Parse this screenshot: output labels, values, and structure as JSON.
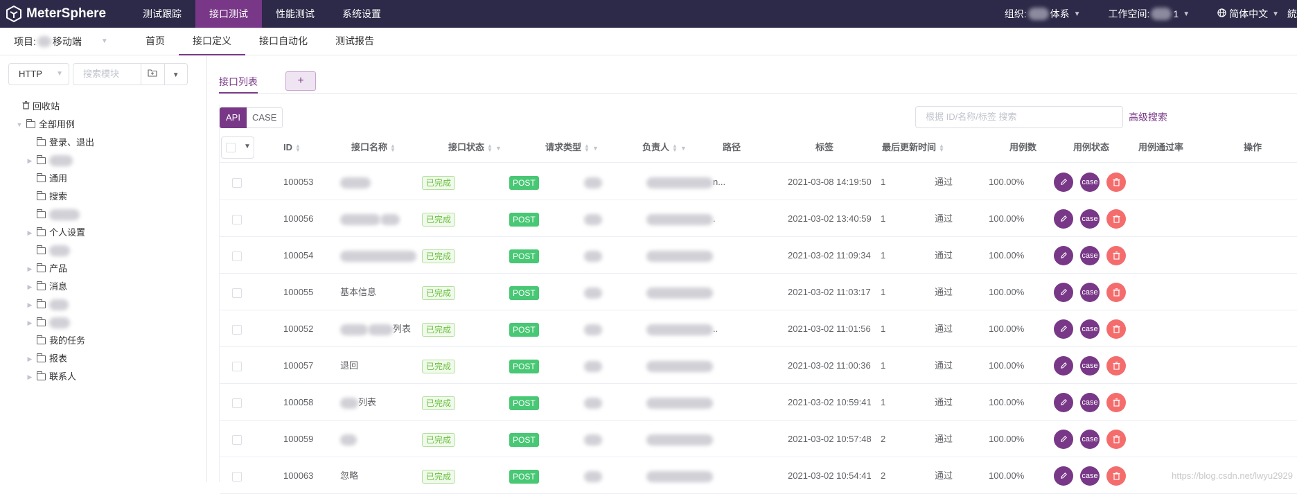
{
  "app": {
    "name": "MeterSphere"
  },
  "topnav": {
    "items": [
      "测试跟踪",
      "接口测试",
      "性能测试",
      "系统设置"
    ],
    "active_index": 1
  },
  "topright": {
    "org_label": "组织:",
    "org_value": "体系",
    "workspace_label": "工作空间:",
    "language": "简体中文"
  },
  "subbar": {
    "project_label": "项目:",
    "project_value": "移动端",
    "items": [
      "首页",
      "接口定义",
      "接口自动化",
      "测试报告"
    ],
    "active_index": 1
  },
  "left": {
    "protocol": "HTTP",
    "search_placeholder": "搜索模块",
    "tree": [
      {
        "label": "回收站",
        "level": 1,
        "type": "trash"
      },
      {
        "label": "全部用例",
        "level": 1,
        "type": "folder",
        "expanded": true
      },
      {
        "label": "登录、退出",
        "level": 2,
        "type": "folder"
      },
      {
        "label": "",
        "level": 2,
        "type": "folder",
        "collapsed": true,
        "blur": 34
      },
      {
        "label": "通用",
        "level": 2,
        "type": "folder"
      },
      {
        "label": "搜索",
        "level": 2,
        "type": "folder"
      },
      {
        "label": "",
        "level": 2,
        "type": "folder",
        "blur": 44
      },
      {
        "label": "个人设置",
        "level": 2,
        "type": "folder",
        "collapsed": true
      },
      {
        "label": "",
        "level": 2,
        "type": "folder",
        "blur": 30
      },
      {
        "label": "产品",
        "level": 2,
        "type": "folder",
        "collapsed": true
      },
      {
        "label": "消息",
        "level": 2,
        "type": "folder",
        "collapsed": true
      },
      {
        "label": "",
        "level": 2,
        "type": "folder",
        "collapsed": true,
        "blur": 28
      },
      {
        "label": "",
        "level": 2,
        "type": "folder",
        "collapsed": true,
        "blur": 30
      },
      {
        "label": "我的任务",
        "level": 2,
        "type": "folder"
      },
      {
        "label": "报表",
        "level": 2,
        "type": "folder",
        "collapsed": true
      },
      {
        "label": "联系人",
        "level": 2,
        "type": "folder",
        "collapsed": true
      }
    ]
  },
  "main": {
    "tab_label": "接口列表",
    "add_tab": "+",
    "mode_api": "API",
    "mode_case": "CASE",
    "search_placeholder": "根据 ID/名称/标签 搜索",
    "advanced_search": "高级搜索",
    "columns": {
      "id": "ID",
      "name": "接口名称",
      "status": "接口状态",
      "method": "请求类型",
      "owner": "负责人",
      "path": "路径",
      "tags": "标签",
      "updated": "最后更新时间",
      "case_count": "用例数",
      "case_status": "用例状态",
      "pass_rate": "用例通过率",
      "ops": "操作"
    },
    "rows": [
      {
        "id": "100053",
        "name": "",
        "name_suffix": "",
        "status": "已完成",
        "method": "POST",
        "path_suffix": "n...",
        "updated": "2021-03-08 14:19:50",
        "case_count": "1",
        "case_status": "通过",
        "pass_rate": "100.00%"
      },
      {
        "id": "100056",
        "name": "",
        "name_suffix": "",
        "status": "已完成",
        "method": "POST",
        "path_suffix": ".",
        "updated": "2021-03-02 13:40:59",
        "case_count": "1",
        "case_status": "通过",
        "pass_rate": "100.00%"
      },
      {
        "id": "100054",
        "name": "",
        "name_suffix": "",
        "status": "已完成",
        "method": "POST",
        "path_suffix": "",
        "updated": "2021-03-02 11:09:34",
        "case_count": "1",
        "case_status": "通过",
        "pass_rate": "100.00%"
      },
      {
        "id": "100055",
        "name": "基本信息",
        "name_suffix": "",
        "status": "已完成",
        "method": "POST",
        "path_suffix": "",
        "updated": "2021-03-02 11:03:17",
        "case_count": "1",
        "case_status": "通过",
        "pass_rate": "100.00%"
      },
      {
        "id": "100052",
        "name": "",
        "name_suffix": "列表",
        "status": "已完成",
        "method": "POST",
        "path_suffix": "..",
        "updated": "2021-03-02 11:01:56",
        "case_count": "1",
        "case_status": "通过",
        "pass_rate": "100.00%"
      },
      {
        "id": "100057",
        "name": "退回",
        "name_suffix": "",
        "status": "已完成",
        "method": "POST",
        "path_suffix": "",
        "updated": "2021-03-02 11:00:36",
        "case_count": "1",
        "case_status": "通过",
        "pass_rate": "100.00%"
      },
      {
        "id": "100058",
        "name": "",
        "name_suffix": "列表",
        "status": "已完成",
        "method": "POST",
        "path_suffix": "",
        "updated": "2021-03-02 10:59:41",
        "case_count": "1",
        "case_status": "通过",
        "pass_rate": "100.00%"
      },
      {
        "id": "100059",
        "name": "",
        "name_suffix": "",
        "status": "已完成",
        "method": "POST",
        "path_suffix": "",
        "updated": "2021-03-02 10:57:48",
        "case_count": "2",
        "case_status": "通过",
        "pass_rate": "100.00%"
      },
      {
        "id": "100063",
        "name": "忽略",
        "name_suffix": "",
        "status": "已完成",
        "method": "POST",
        "path_suffix": "",
        "updated": "2021-03-02 10:54:41",
        "case_count": "2",
        "case_status": "通过",
        "pass_rate": "100.00%"
      }
    ],
    "op_case_label": "case"
  },
  "watermark": "https://blog.csdn.net/lwyu2929"
}
